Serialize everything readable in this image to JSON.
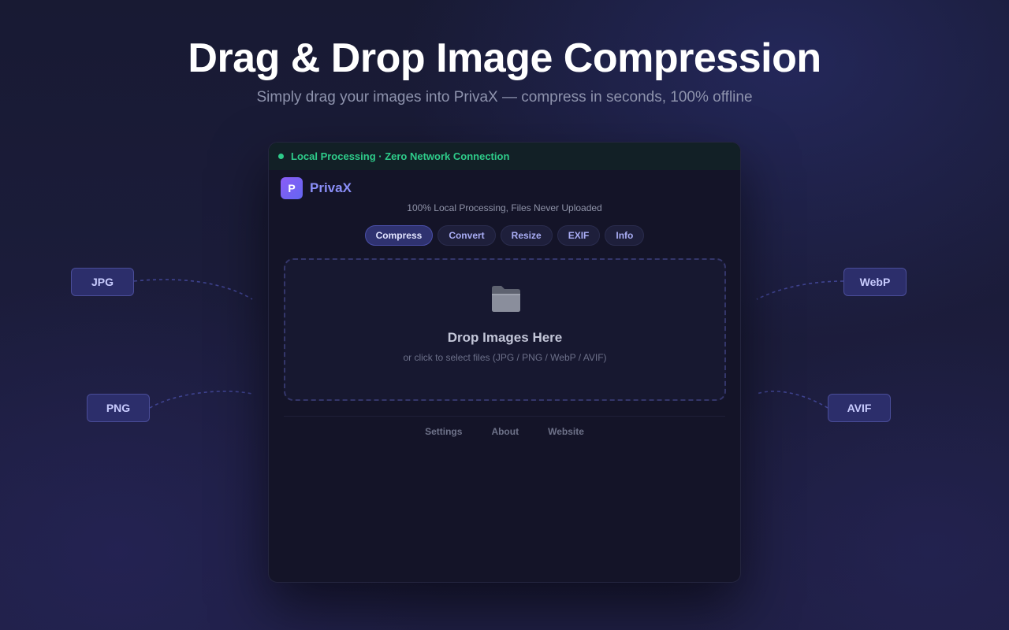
{
  "hero": {
    "title": "Drag & Drop Image Compression",
    "subtitle": "Simply drag your images into PrivaX — compress in seconds, 100% offline"
  },
  "formats": {
    "left_top": "JPG",
    "left_bottom": "PNG",
    "right_top": "WebP",
    "right_bottom": "AVIF"
  },
  "window": {
    "status_text": "Local Processing · Zero Network Connection",
    "logo_letter": "P",
    "app_name": "PrivaX",
    "tagline": "100% Local Processing, Files Never Uploaded",
    "tabs": [
      "Compress",
      "Convert",
      "Resize",
      "EXIF",
      "Info"
    ],
    "active_tab": "Compress",
    "drop_zone": {
      "icon": "folder-icon",
      "title": "Drop Images Here",
      "hint": "or click to select files (JPG / PNG / WebP / AVIF)"
    },
    "footer_links": [
      "Settings",
      "About",
      "Website"
    ]
  },
  "colors": {
    "accent": "#8b8ff8",
    "status": "#2ecc8a",
    "tag_bg": "#2c2e6b"
  }
}
